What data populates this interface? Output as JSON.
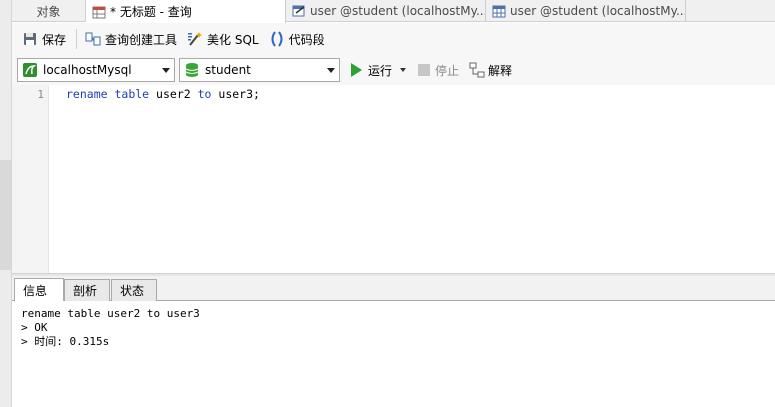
{
  "tabs": [
    {
      "label": "对象",
      "icon": "none",
      "active": false
    },
    {
      "label": "* 无标题 - 查询",
      "icon": "query-table-icon",
      "active": true
    },
    {
      "label": "user @student (localhostMy...",
      "icon": "table-edit-icon",
      "active": false
    },
    {
      "label": "user @student (localhostMy...",
      "icon": "table-grid-icon",
      "active": false
    }
  ],
  "toolbar": {
    "save_label": "保存",
    "query_builder_label": "查询创建工具",
    "beautify_label": "美化 SQL",
    "snippet_label": "代码段"
  },
  "connection": {
    "selected": "localhostMysql",
    "database": "student"
  },
  "actions": {
    "run_label": "运行",
    "stop_label": "停止",
    "explain_label": "解释"
  },
  "editor": {
    "line_number": "1",
    "tokens": {
      "kw1": "rename",
      "kw2": "table",
      "id1": "user2",
      "kw3": "to",
      "id2": "user3;"
    }
  },
  "result_tabs": {
    "info": "信息",
    "profile": "剖析",
    "status": "状态"
  },
  "output": {
    "line1": "rename table user2 to user3",
    "line2": "> OK",
    "line3": "> 时间: 0.315s"
  },
  "colors": {
    "keyword": "#1f3dbf",
    "run_green": "#2ea12e",
    "db_green": "#3aa63a"
  }
}
